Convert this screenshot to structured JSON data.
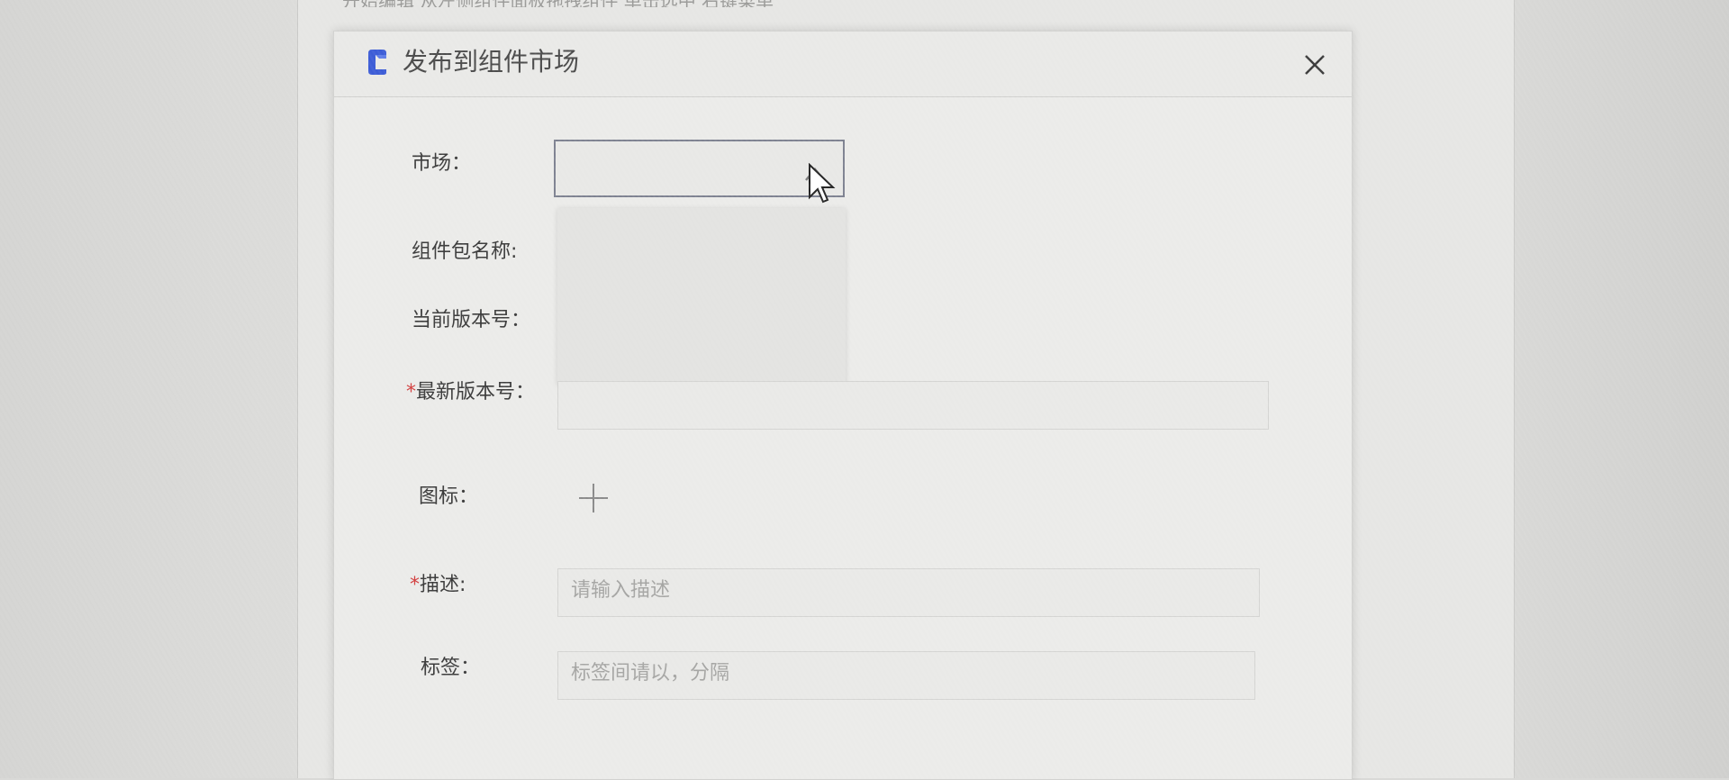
{
  "background_window": {
    "partial_text": "开始编辑  从左侧组件面板拖拽组件  单击选中  右键菜单"
  },
  "dialog": {
    "title": "发布到组件市场",
    "close_icon": "close-icon",
    "fields": {
      "market": {
        "label": "市场：",
        "value": ""
      },
      "package_name": {
        "label": "组件包名称:"
      },
      "current_version": {
        "label": "当前版本号："
      },
      "latest_version": {
        "required_mark": "*",
        "label": "最新版本号：",
        "value": ""
      },
      "icon": {
        "label": "图标：",
        "add_icon": "plus-icon"
      },
      "description": {
        "required_mark": "*",
        "label": "描述:",
        "placeholder": "请输入描述"
      },
      "tags": {
        "label": "标签：",
        "placeholder": "标签间请以，分隔"
      }
    }
  },
  "colors": {
    "required": "#d23c3c",
    "select_border": "#7d8190",
    "logo_blue": "#3b5bd6"
  }
}
